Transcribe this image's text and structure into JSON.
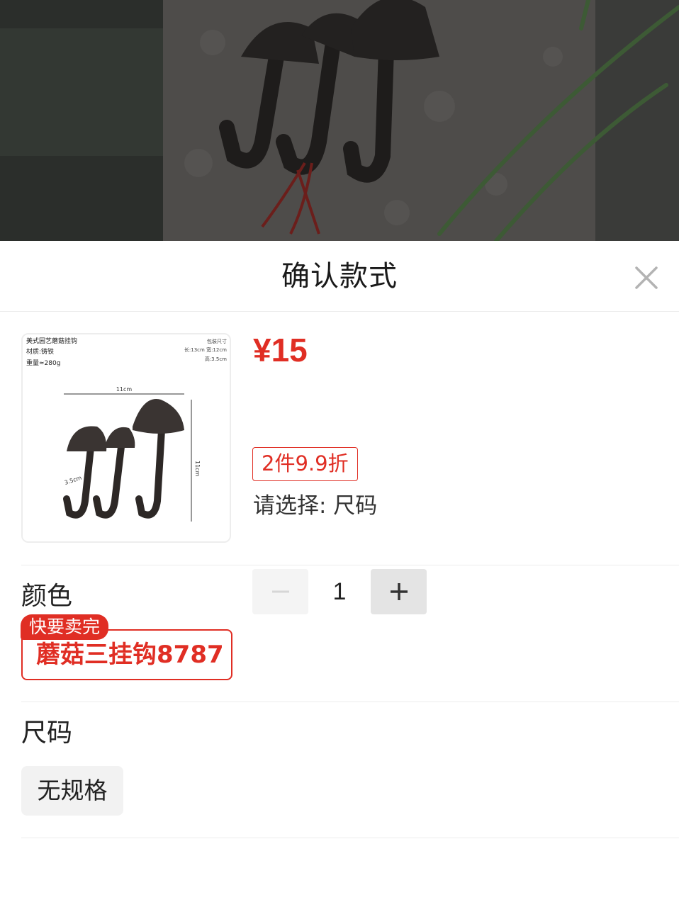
{
  "sheet": {
    "title": "确认款式",
    "close_icon": "close-icon"
  },
  "product": {
    "thumbnail": {
      "title": "美式园艺蘑菇挂钩",
      "material": "材质:铸铁",
      "weight": "重量≈280g",
      "pack_label": "包装尺寸",
      "pack_dims": "长:13cm  宽:12cm",
      "pack_height": "高:3.5cm",
      "width_label": "11cm",
      "height_label": "11cm",
      "depth_label": "3.5cm"
    },
    "price": "¥15",
    "promo": "2件9.9折",
    "select_hint": "请选择: 尺码"
  },
  "quantity": {
    "value": "1",
    "minus_icon": "minus-icon",
    "plus_icon": "plus-icon"
  },
  "color_section": {
    "label": "颜色",
    "badge": "快要卖完",
    "option": "蘑菇三挂钩8787"
  },
  "size_section": {
    "label": "尺码",
    "option": "无规格"
  },
  "colors": {
    "accent": "#e02e24",
    "divider": "#ececec"
  }
}
